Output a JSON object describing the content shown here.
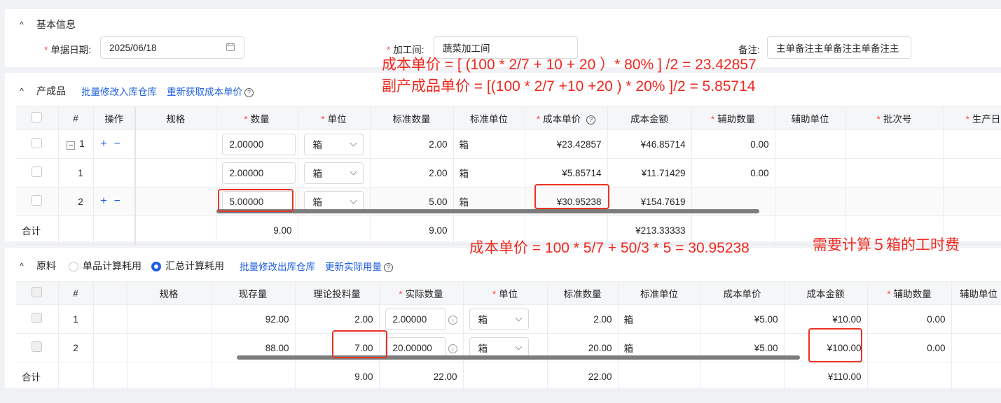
{
  "basic": {
    "title": "基本信息",
    "date_label": "单据日期:",
    "date_value": "2025/06/18",
    "workshop_label": "加工间:",
    "workshop_value": "蔬菜加工间",
    "remark_label": "备注:",
    "remark_value": "主单备注主单备注主单备注主"
  },
  "products": {
    "title": "产成品",
    "batch_modify": "批量修改入库仓库",
    "refetch_cost": "重新获取成本单价",
    "headers": [
      "#",
      "操作",
      "规格",
      "数量",
      "单位",
      "标准数量",
      "标准单位",
      "成本单价",
      "成本金额",
      "辅助数量",
      "辅助单位",
      "批次号",
      "生产日"
    ],
    "rows": [
      {
        "idx": "1",
        "collapse": "–",
        "qty": "2.00000",
        "unit": "箱",
        "std_qty": "2.00",
        "std_unit": "箱",
        "cost": "¥23.42857",
        "amount": "¥46.85714",
        "aux_qty": "0.00"
      },
      {
        "idx": "1",
        "qty": "2.00000",
        "unit": "箱",
        "std_qty": "2.00",
        "std_unit": "箱",
        "cost": "¥5.85714",
        "amount": "¥11.71429",
        "aux_qty": "0.00"
      },
      {
        "idx": "2",
        "qty": "5.00000",
        "unit": "箱",
        "std_qty": "5.00",
        "std_unit": "箱",
        "cost": "¥30.95238",
        "amount": "¥154.7619",
        "aux_qty": ""
      }
    ],
    "total": {
      "label": "合计",
      "qty": "9.00",
      "std_qty": "9.00",
      "amount": "¥213.33333"
    }
  },
  "materials": {
    "title": "原料",
    "radio_single": "单品计算耗用",
    "radio_summary": "汇总计算耗用",
    "batch_modify": "批量修改出库仓库",
    "update_actual": "更新实际用量",
    "headers": [
      "#",
      "规格",
      "现存量",
      "理论投料量",
      "实际数量",
      "单位",
      "标准数量",
      "标准单位",
      "成本单价",
      "成本金额",
      "辅助数量",
      "辅助单位"
    ],
    "rows": [
      {
        "idx": "1",
        "stock": "92.00",
        "theory": "2.00",
        "actual": "2.00000",
        "unit": "箱",
        "std_qty": "2.00",
        "std_unit": "箱",
        "cost": "¥5.00",
        "amount": "¥10.00",
        "aux_qty": "0.00"
      },
      {
        "idx": "2",
        "stock": "88.00",
        "theory": "7.00",
        "actual": "20.00000",
        "unit": "箱",
        "std_qty": "20.00",
        "std_unit": "箱",
        "cost": "¥5.00",
        "amount": "¥100.00",
        "aux_qty": "0.00"
      }
    ],
    "total": {
      "label": "合计",
      "theory": "9.00",
      "actual": "22.00",
      "std_qty": "22.00",
      "amount": "¥110.00"
    }
  },
  "annotations": {
    "line1": "成本单价 = [ (100 * 2/7  + 10 + 20 ）* 80% ] /2 = 23.42857",
    "line2": "副产成品单价 = [(100 * 2/7 +10 +20 ) * 20% ]/2 = 5.85714",
    "line3": "成本单价 = 100 * 5/7  + 50/3 * 5 = 30.95238",
    "line4": "需要计算５箱的工时费"
  },
  "icons": {
    "calendar": "calendar-icon",
    "help": "question-circle-icon",
    "info": "info-circle-icon",
    "caret": "caret-up-icon"
  },
  "colors": {
    "link": "#1f5fe0",
    "required": "#ff4d4f",
    "annotation": "#f0281e"
  }
}
